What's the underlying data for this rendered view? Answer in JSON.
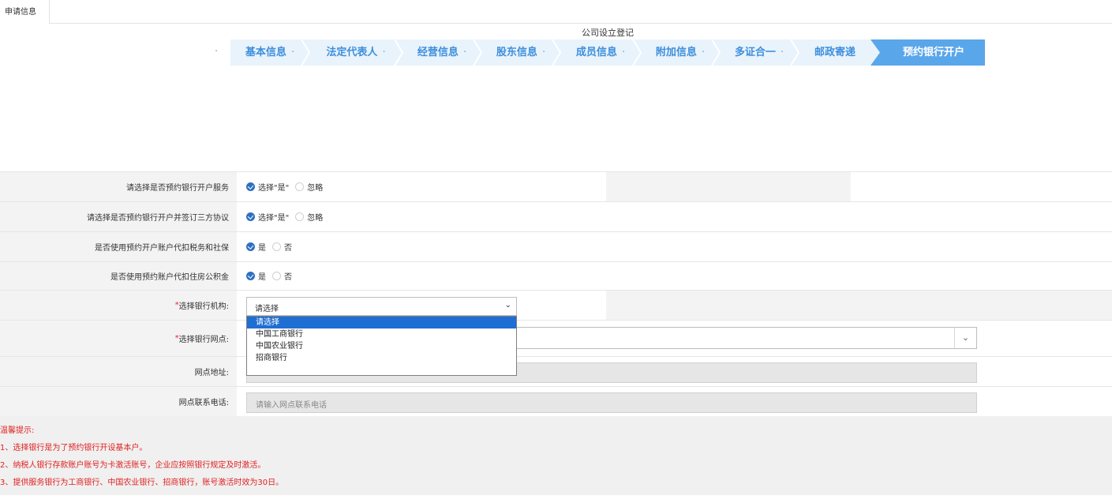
{
  "tab": {
    "label": "申请信息"
  },
  "flow": {
    "title": "公司设立登记",
    "steps": [
      "基本信息",
      "法定代表人",
      "经营信息",
      "股东信息",
      "成员信息",
      "附加信息",
      "多证合一",
      "邮政寄递"
    ],
    "active_step": "预约银行开户"
  },
  "form": {
    "rows": [
      {
        "label": "请选择是否预约银行开户服务",
        "opt_on": "选择\"是\"",
        "opt_off": "忽略"
      },
      {
        "label": "请选择是否预约银行开户并签订三方协议",
        "opt_on": "选择\"是\"",
        "opt_off": "忽略"
      },
      {
        "label": "是否使用预约开户账户代扣税务和社保",
        "opt_on": "是",
        "opt_off": "否"
      },
      {
        "label": "是否使用预约账户代扣住房公积金",
        "opt_on": "是",
        "opt_off": "否"
      }
    ],
    "bank": {
      "label": "选择银行机构:",
      "required_mark": "*",
      "value": "请选择"
    },
    "branch": {
      "label": "选择银行网点:",
      "required_mark": "*"
    },
    "address": {
      "label": "网点地址:"
    },
    "phone": {
      "label": "网点联系电话:",
      "placeholder": "请输入网点联系电话"
    }
  },
  "dropdown": {
    "options": [
      "请选择",
      "中国工商银行",
      "中国农业银行",
      "招商银行"
    ],
    "selected_index": 0
  },
  "tips": {
    "title": "温馨提示:",
    "lines": [
      "1、选择银行是为了预约银行开设基本户。",
      "2、纳税人银行存款账户账号为卡激活账号，企业应按照银行规定及时激活。",
      "3、提供服务银行为工商银行、中国农业银行、招商银行，账号激活时效为30日。"
    ]
  },
  "colors": {
    "accent": "#3d8fdc",
    "active_step": "#5aa6ea",
    "warning": "#e02020",
    "selected_option": "#1e6ed3"
  }
}
